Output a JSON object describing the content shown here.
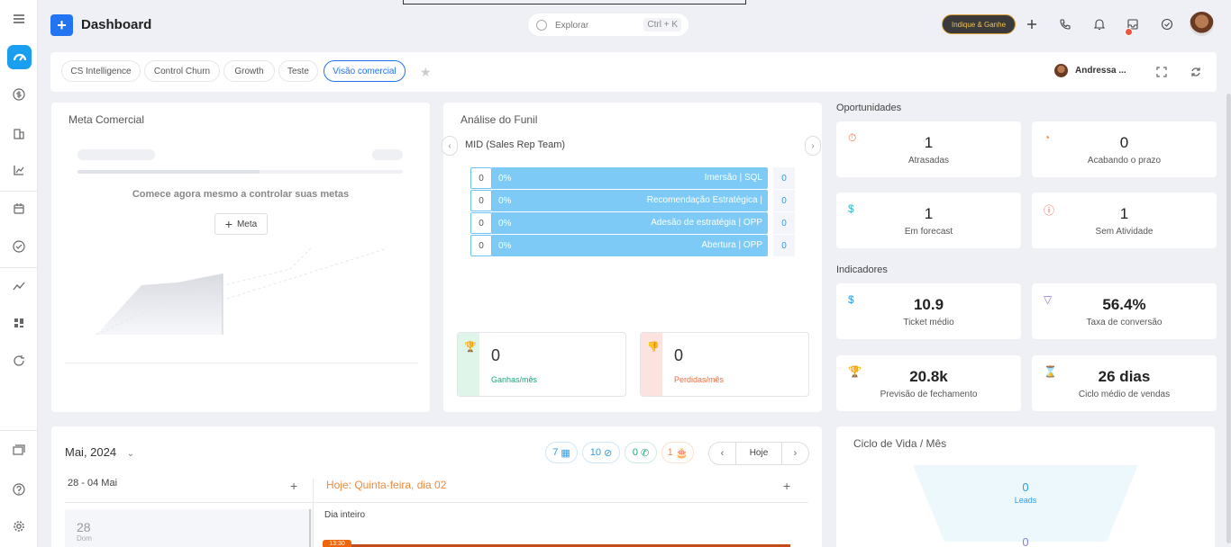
{
  "header": {
    "title": "Dashboard",
    "search_placeholder": "Explorar",
    "search_shortcut": "Ctrl + K",
    "promo_label": "Indique & Ganhe"
  },
  "tabs": [
    {
      "label": "CS Intelligence",
      "active": false
    },
    {
      "label": "Control Churn",
      "active": false
    },
    {
      "label": "Growth",
      "active": false
    },
    {
      "label": "Teste",
      "active": false
    },
    {
      "label": "Visão comercial",
      "active": true
    }
  ],
  "user": {
    "name": "Andressa ..."
  },
  "meta_comercial": {
    "title": "Meta Comercial",
    "empty_text": "Comece agora mesmo a controlar suas metas",
    "button_label": "Meta"
  },
  "funil": {
    "title": "Análise do Funil",
    "subtitle": "MID (Sales Rep Team)",
    "stages": [
      {
        "count": "0",
        "pct": "0%",
        "label": "Imersão | SQL",
        "value": "0"
      },
      {
        "count": "0",
        "pct": "0%",
        "label": "Recomendação Estratégica |",
        "value": "0"
      },
      {
        "count": "0",
        "pct": "0%",
        "label": "Adesão de estratégia | OPP",
        "value": "0"
      },
      {
        "count": "0",
        "pct": "0%",
        "label": "Abertura | OPP",
        "value": "0"
      }
    ],
    "won": {
      "value": "0",
      "label": "Ganhas/mês"
    },
    "lost": {
      "value": "0",
      "label": "Perdidas/mês"
    }
  },
  "oportunidades": {
    "title": "Oportunidades",
    "items": [
      {
        "value": "1",
        "label": "Atrasadas",
        "icon": "stopwatch-icon",
        "color": "#f06a3c"
      },
      {
        "value": "0",
        "label": "Acabando o prazo",
        "icon": "timer-icon",
        "color": "#f08a3c"
      },
      {
        "value": "1",
        "label": "Em forecast",
        "icon": "dollar-icon",
        "color": "#2cb9c9"
      },
      {
        "value": "1",
        "label": "Sem Atividade",
        "icon": "alert-icon",
        "color": "#f0553c"
      }
    ]
  },
  "indicadores": {
    "title": "Indicadores",
    "items": [
      {
        "value": "10.9",
        "label": "Ticket médio",
        "icon": "dollar-icon",
        "color": "#2c9de8"
      },
      {
        "value": "56.4%",
        "label": "Taxa de conversão",
        "icon": "filter-icon",
        "color": "#8a7fd6"
      },
      {
        "value": "20.8k",
        "label": "Previsão de fechamento",
        "icon": "trophy-icon",
        "color": "#2cb9c9"
      },
      {
        "value": "26 dias",
        "label": "Ciclo médio de vendas",
        "icon": "hourglass-icon",
        "color": "#2c9de8"
      }
    ]
  },
  "calendar": {
    "month": "Mai, 2024",
    "chips": [
      {
        "value": "7",
        "icon": "calendar-icon",
        "color": "#2c9de8"
      },
      {
        "value": "10",
        "icon": "check-icon",
        "color": "#2c9de8"
      },
      {
        "value": "0",
        "icon": "phone-icon",
        "color": "#1aa37a"
      },
      {
        "value": "1",
        "icon": "gift-icon",
        "color": "#f08a3c"
      }
    ],
    "today_label": "Hoje",
    "week_range": "28 - 04 Mai",
    "today_title": "Hoje: Quinta-feira, dia 02",
    "all_day": "Dia inteiro",
    "day_num": "28",
    "day_name": "Dom",
    "event_time": "13:30"
  },
  "ciclo": {
    "title": "Ciclo de Vida / Mês",
    "leads_value": "0",
    "leads_label": "Leads",
    "next_value": "0"
  }
}
